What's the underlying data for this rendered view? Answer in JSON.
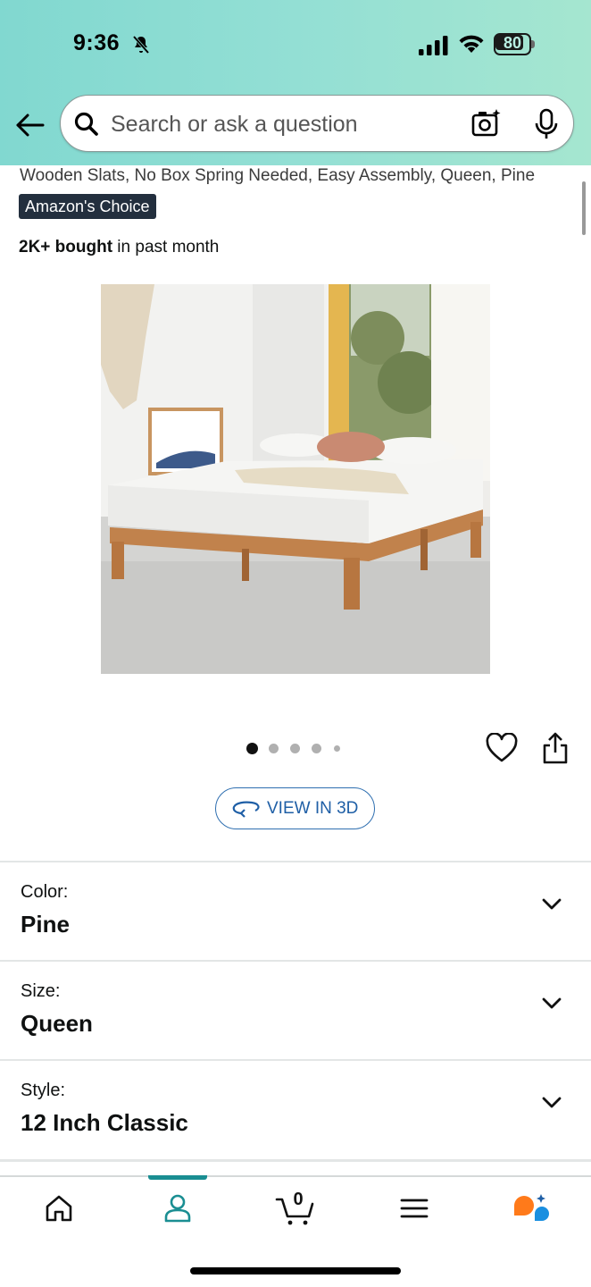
{
  "status_bar": {
    "time": "9:36",
    "battery": "80"
  },
  "search": {
    "placeholder": "Search or ask a question"
  },
  "product": {
    "title_fragment": "Wooden Slats, No Box Spring Needed, Easy Assembly, Queen, Pine",
    "badge": "Amazon's Choice",
    "bought_bold": "2K+ bought",
    "bought_rest": " in past month",
    "image_dots": {
      "count": 5,
      "active": 0
    }
  },
  "view_3d": {
    "label": "VIEW IN 3D"
  },
  "variations": [
    {
      "label": "Color:",
      "value": "Pine"
    },
    {
      "label": "Size:",
      "value": "Queen"
    },
    {
      "label": "Style:",
      "value": "12 Inch Classic"
    }
  ],
  "cart": {
    "count": "0"
  },
  "bottom_nav": {
    "items": [
      "home-icon",
      "account-icon",
      "cart-icon",
      "menu-icon",
      "rufus-icon"
    ],
    "active": "account-icon"
  },
  "colors": {
    "header_start": "#81d8d0",
    "header_end": "#a5e6d0",
    "badge_bg": "#232f3e",
    "link_blue": "#1f5fa6",
    "nav_active": "#1a8e92",
    "rufus_orange": "#ff7a1a",
    "rufus_blue": "#1a8fe0"
  }
}
